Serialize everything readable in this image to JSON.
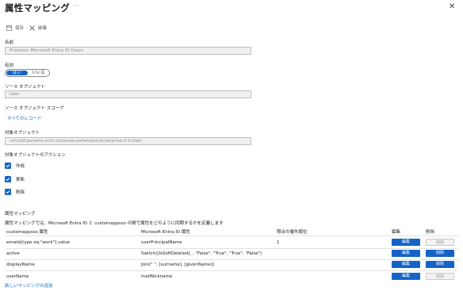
{
  "header": {
    "title": "属性マッピング",
    "more_label": "···",
    "close_label": "✕"
  },
  "toolbar": {
    "save_label": "保存",
    "discard_label": "破棄"
  },
  "form": {
    "name_label": "名前",
    "name_value": "Provision Microsoft Entra ID Users",
    "enabled_label": "有効",
    "enabled_yes": "はい",
    "enabled_no": "いいえ",
    "enabled_selected": "はい",
    "source_object_label": "ソース オブジェクト",
    "source_object_value": "User",
    "source_scope_label": "ソース オブジェクト スコープ",
    "source_scope_link": "すべてのレコード",
    "target_object_label": "対象オブジェクト",
    "target_object_value": "urn:ietf:params:scim:schemas:extension:enterprise:2.0:User",
    "target_actions_label": "対象オブジェクトのアクション",
    "actions": [
      {
        "label": "作成",
        "checked": true
      },
      {
        "label": "更新",
        "checked": true
      },
      {
        "label": "削除",
        "checked": true
      }
    ]
  },
  "mappings": {
    "section_title": "属性マッピング",
    "description": "属性マッピングでは、Microsoft Entra ID と customappsso の間で属性をどのように同期するかを定義します",
    "columns": {
      "target": "customappsso 属性",
      "source": "Microsoft Entra ID 属性",
      "precedence": "照合の優先順位",
      "edit": "編集",
      "delete": "削除"
    },
    "rows": [
      {
        "target": "emails[type eq \"work\"].value",
        "source": "userPrincipalName",
        "precedence": "1",
        "edit_label": "編集",
        "delete_label": "削除",
        "delete_enabled": false
      },
      {
        "target": "active",
        "source": "Switch([IsSoftDeleted], , \"False\", \"True\", \"True\", \"False\")",
        "precedence": "",
        "edit_label": "編集",
        "delete_label": "削除",
        "delete_enabled": true
      },
      {
        "target": "displayName",
        "source": "Join(\" \", [surname], [givenName])",
        "precedence": "",
        "edit_label": "編集",
        "delete_label": "削除",
        "delete_enabled": true
      },
      {
        "target": "userName",
        "source": "mailNickname",
        "precedence": "",
        "edit_label": "編集",
        "delete_label": "削除",
        "delete_enabled": false
      }
    ],
    "add_link": "新しいマッピングの追加"
  },
  "colors": {
    "accent": "#1464c8",
    "field_bg": "#f0f0f0"
  }
}
